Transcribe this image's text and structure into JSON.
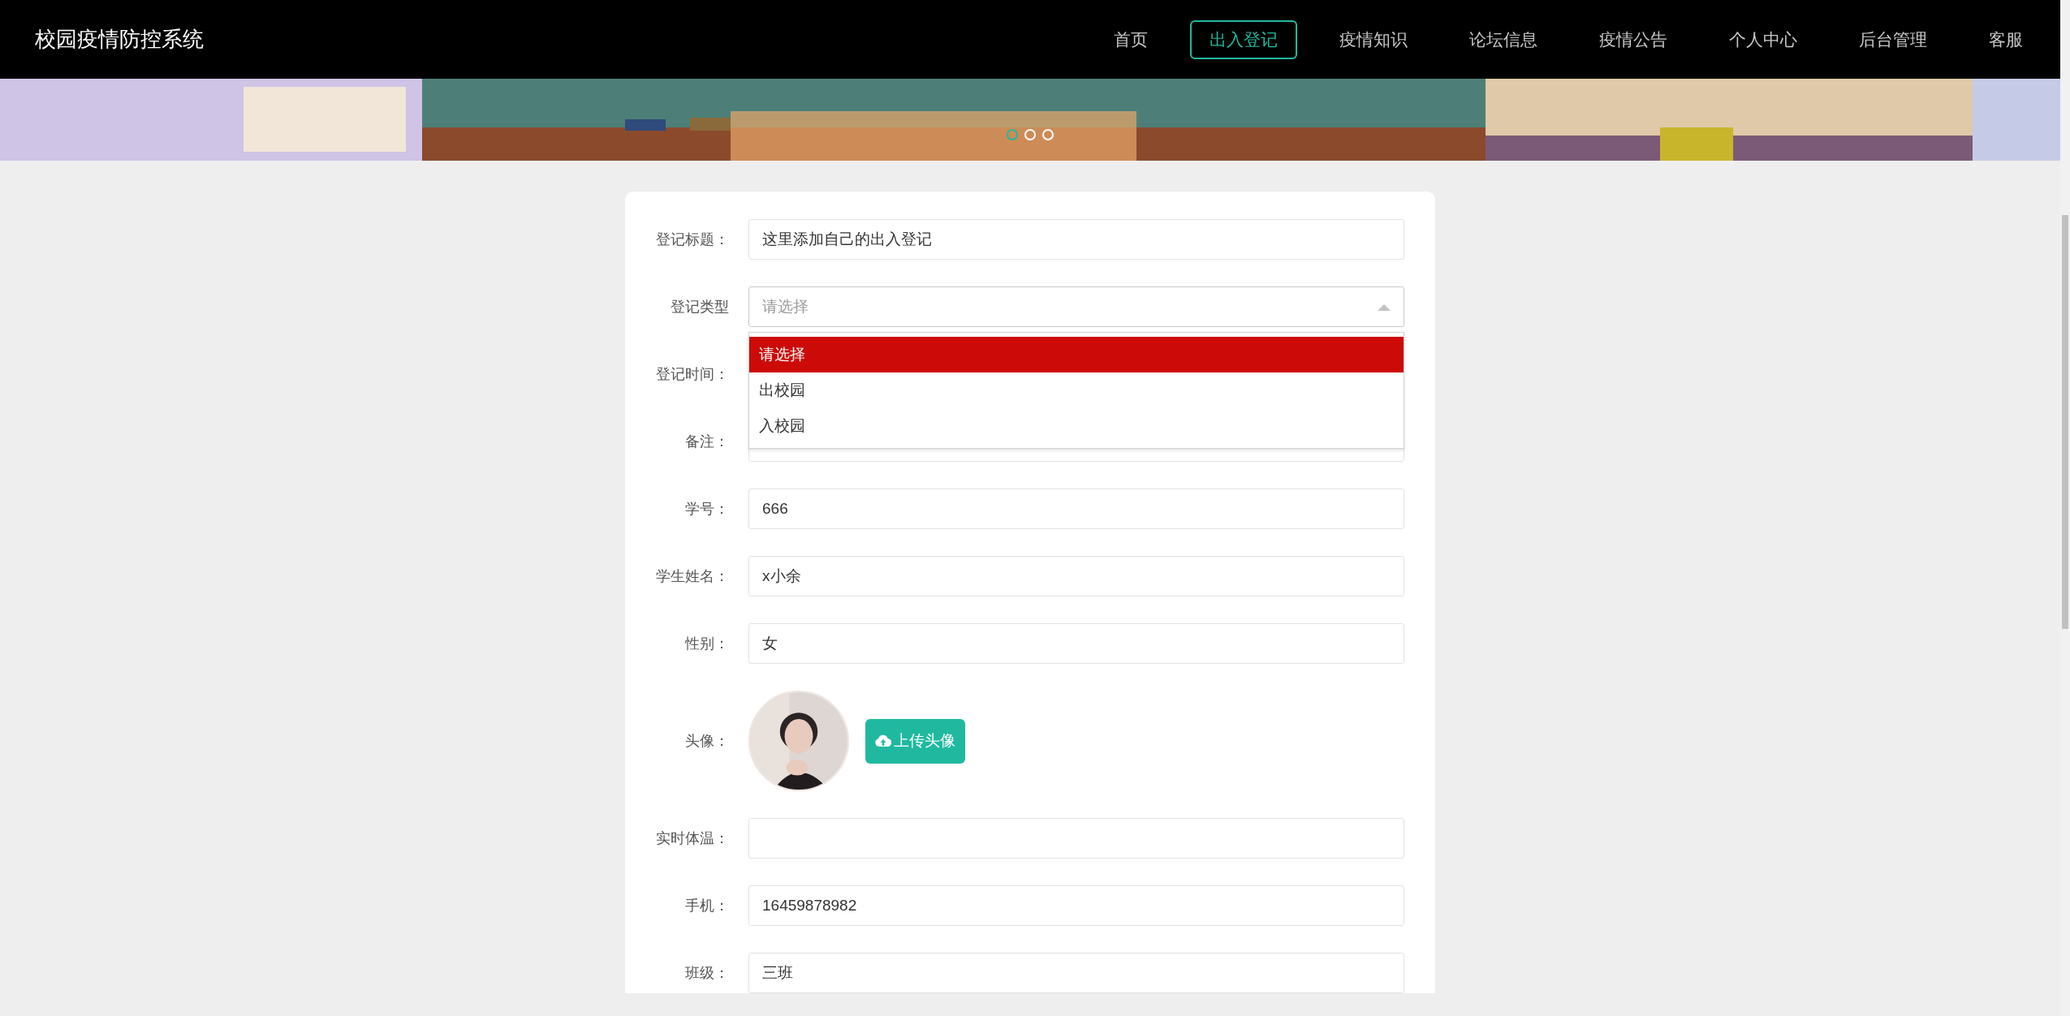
{
  "header": {
    "title": "校园疫情防控系统",
    "nav": [
      {
        "label": "首页",
        "selected": false
      },
      {
        "label": "出入登记",
        "selected": true
      },
      {
        "label": "疫情知识",
        "selected": false
      },
      {
        "label": "论坛信息",
        "selected": false
      },
      {
        "label": "疫情公告",
        "selected": false
      },
      {
        "label": "个人中心",
        "selected": false
      },
      {
        "label": "后台管理",
        "selected": false
      },
      {
        "label": "客服",
        "selected": false
      }
    ]
  },
  "banner": {
    "kind": "picture",
    "dots": [
      {
        "selected": true
      },
      {
        "selected": false
      },
      {
        "selected": false
      }
    ]
  },
  "form": {
    "fields": [
      {
        "kind": "text",
        "label": "登记标题：",
        "value": "这里添加自己的出入登记"
      },
      {
        "kind": "select",
        "label": "登记类型",
        "placeholder": "请选择",
        "expanded": true,
        "options": [
          {
            "label": "请选择",
            "selected": true
          },
          {
            "label": "出校园",
            "selected": false
          },
          {
            "label": "入校园",
            "selected": false
          }
        ]
      },
      {
        "kind": "covered",
        "label": "登记时间："
      },
      {
        "kind": "text",
        "label": "备注："
      },
      {
        "kind": "text",
        "label": "学号：",
        "value": "666"
      },
      {
        "kind": "text",
        "label": "学生姓名：",
        "value": "x小余"
      },
      {
        "kind": "text",
        "label": "性别：",
        "value": "女"
      },
      {
        "kind": "avatar",
        "label": "头像：",
        "button": "上传头像"
      },
      {
        "kind": "text",
        "label": "实时体温："
      },
      {
        "kind": "text",
        "label": "手机：",
        "value": "16459878982"
      },
      {
        "kind": "text",
        "label": "班级：",
        "value": "三班"
      }
    ]
  }
}
